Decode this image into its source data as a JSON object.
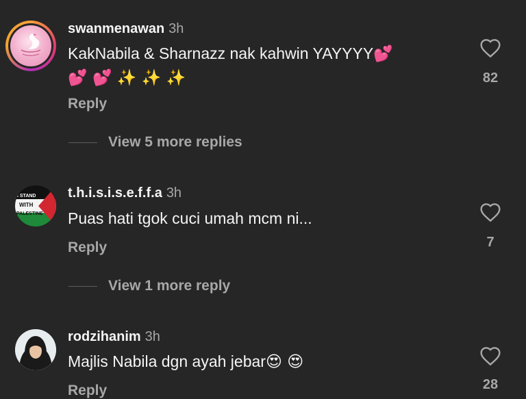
{
  "comments": [
    {
      "username": "swanmenawan",
      "time": "3h",
      "text_line1": "KakNabila & Sharnazz nak kahwin YAYYYY",
      "text_line1_emoji": "💕",
      "text_line2_emoji": "💕 💕 ✨ ✨ ✨",
      "reply_label": "Reply",
      "like_count": "82",
      "view_more": "View 5 more replies"
    },
    {
      "username": "t.h.i.s.i.s.e.f.f.a",
      "time": "3h",
      "text": "Puas hati tgok cuci umah mcm ni...",
      "reply_label": "Reply",
      "like_count": "7",
      "view_more": "View 1 more reply",
      "avatar_text": [
        "I STAND",
        "WITH",
        "PALESTINE"
      ]
    },
    {
      "username": "rodzihanim",
      "time": "3h",
      "text": "Majlis Nabila dgn ayah jebar",
      "text_emoji": "😍 😍",
      "reply_label": "Reply",
      "like_count": "28"
    }
  ],
  "icons": {
    "like": "heart-outline-icon"
  },
  "colors": {
    "background": "#262626",
    "primary_text": "#f5f5f5",
    "secondary_text": "#a8a8a8"
  }
}
